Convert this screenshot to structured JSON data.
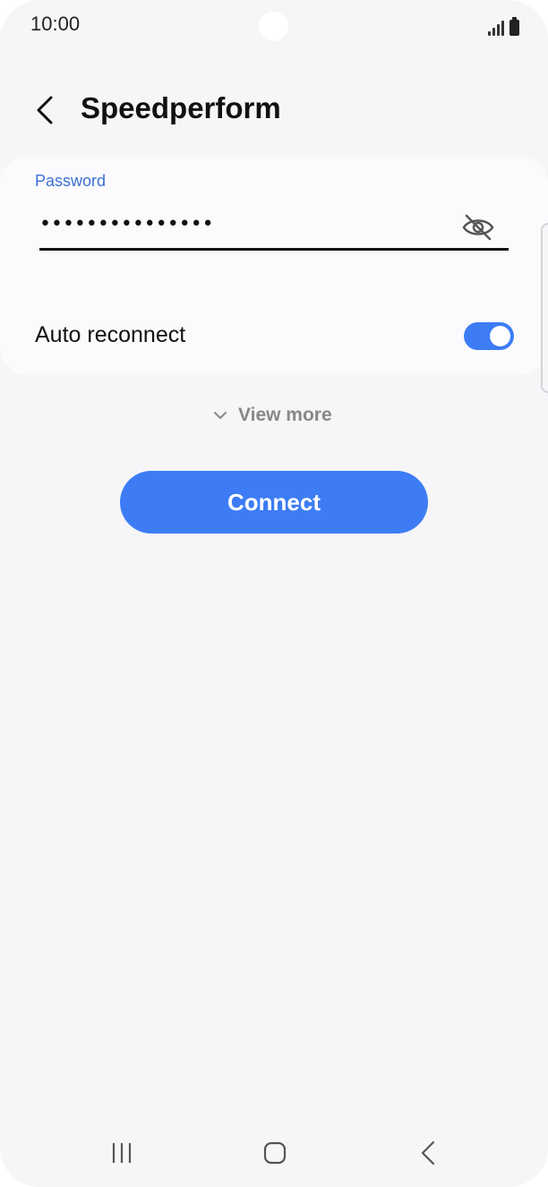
{
  "status_bar": {
    "time": "10:00"
  },
  "header": {
    "title": "Speedperform",
    "back_icon": "chevron-left-icon"
  },
  "form": {
    "password_label": "Password",
    "password_value": "•••••••••••••••",
    "visibility_icon": "eye-off-icon",
    "auto_reconnect_label": "Auto reconnect",
    "auto_reconnect_on": true
  },
  "view_more_label": "View more",
  "connect_label": "Connect",
  "nav": {
    "recent_icon": "recent-apps-icon",
    "home_icon": "home-icon",
    "back_icon": "back-icon"
  },
  "colors": {
    "accent": "#3d7cf5",
    "label_blue": "#3b6fd4",
    "background": "#f6f6f8"
  }
}
